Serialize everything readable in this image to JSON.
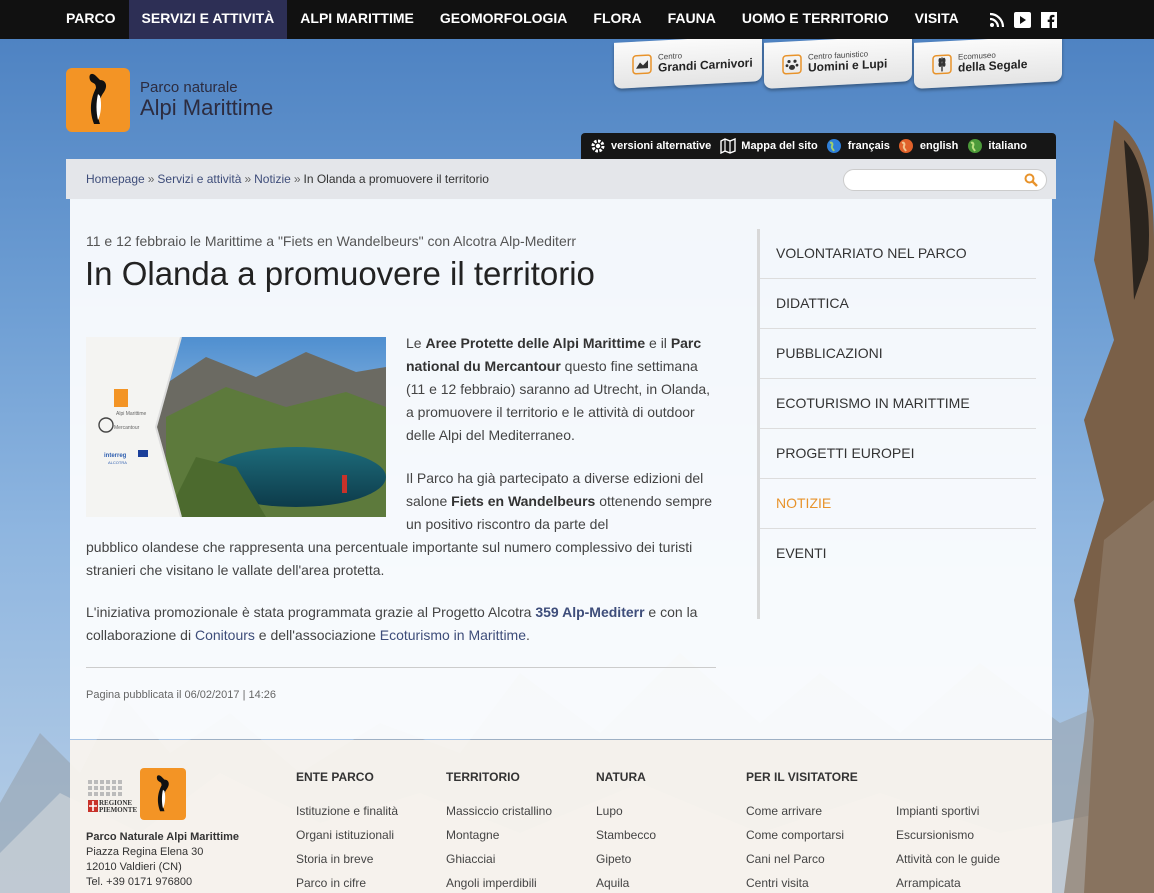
{
  "topnav": {
    "items": [
      "PARCO",
      "SERVIZI E ATTIVITÀ",
      "ALPI MARITTIME",
      "GEOMORFOLOGIA",
      "FLORA",
      "FAUNA",
      "UOMO E TERRITORIO",
      "VISITA"
    ],
    "active_index": 1,
    "social": [
      "rss-icon",
      "youtube-icon",
      "facebook-icon"
    ]
  },
  "logo": {
    "line1": "Parco naturale",
    "line2": "Alpi Marittime"
  },
  "tabs": [
    {
      "small": "Centro",
      "big": "Grandi Carnivori"
    },
    {
      "small": "Centro faunistico",
      "big": "Uomini e Lupi"
    },
    {
      "small": "Ecomuseo",
      "big": "della Segale"
    }
  ],
  "langbar": {
    "items": [
      "versioni alternative",
      "Mappa del sito",
      "français",
      "english",
      "italiano"
    ]
  },
  "breadcrumb": {
    "home": "Homepage",
    "sep": "»",
    "servizi": "Servizi e attività",
    "notizie": "Notizie",
    "current": "In Olanda a promuovere il territorio"
  },
  "search": {
    "placeholder": ""
  },
  "article": {
    "subtitle": "11 e 12 febbraio le Marittime a \"Fiets en Wandelbeurs\" con Alcotra Alp-Mediterr",
    "title": "In Olanda a promuovere il territorio",
    "p1_a": "Le ",
    "p1_b": "Aree Protette delle Alpi Marittime",
    "p1_c": " e il ",
    "p1_d": "Parc national du Mercantour",
    "p1_e": " questo fine settimana (11 e 12 febbraio) saranno ad Utrecht, in Olanda, a promuovere il territorio e le attività di outdoor delle Alpi del Mediterraneo.",
    "p2_a": "Il Parco ha già partecipato a diverse edizioni del salone ",
    "p2_b": "Fiets en Wandelbeurs",
    "p2_c": " ottenendo sempre un positivo riscontro da parte del",
    "p2_d": "pubblico olandese che rappresenta una percentuale importante sul numero complessivo dei turisti stranieri che visitano le vallate dell'area protetta.",
    "p3_a": "L'iniziativa promozionale è stata programmata grazie al Progetto Alcotra ",
    "p3_b": "359 Alp-Mediterr",
    "p3_c": " e con la collaborazione di ",
    "p3_d": "Conitours",
    "p3_e": " e dell'associazione ",
    "p3_f": "Ecoturismo in Marittime",
    "p3_g": ".",
    "pubdate": "Pagina pubblicata il 06/02/2017 | 14:26",
    "figure": {
      "lbl_marittime": "Alpi Marittime",
      "lbl_mercantour": "Mercantour",
      "lbl_interreg": "interreg",
      "lbl_alcotra": "ALCOTRA"
    }
  },
  "sidebar": {
    "items": [
      "VOLONTARIATO NEL PARCO",
      "DIDATTICA",
      "PUBBLICAZIONI",
      "ECOTURISMO IN MARITTIME",
      "PROGETTI EUROPEI",
      "NOTIZIE",
      "EVENTI"
    ],
    "active_index": 5
  },
  "footer": {
    "regione": "REGIONE PIEMONTE",
    "address": {
      "name": "Parco Naturale Alpi Marittime",
      "street": "Piazza Regina Elena 30",
      "city": "12010 Valdieri (CN)",
      "tel": "Tel. +39 0171 976800"
    },
    "columns": [
      {
        "heading": "ENTE PARCO",
        "links": [
          "Istituzione e finalità",
          "Organi istituzionali",
          "Storia in breve",
          "Parco in cifre"
        ]
      },
      {
        "heading": "TERRITORIO",
        "links": [
          "Massiccio cristallino",
          "Montagne",
          "Ghiacciai",
          "Angoli imperdibili"
        ]
      },
      {
        "heading": "NATURA",
        "links": [
          "Lupo",
          "Stambecco",
          "Gipeto",
          "Aquila"
        ]
      },
      {
        "heading": "PER IL VISITATORE",
        "links": [
          "Come arrivare",
          "Come comportarsi",
          "Cani nel Parco",
          "Centri visita"
        ]
      },
      {
        "heading": "",
        "links": [
          "Impianti sportivi",
          "Escursionismo",
          "Attività con le guide",
          "Arrampicata"
        ]
      }
    ]
  },
  "colors": {
    "accent": "#e8932b",
    "link": "#3e4d7a",
    "navActive": "#2d2f55",
    "logo": "#f39425"
  }
}
